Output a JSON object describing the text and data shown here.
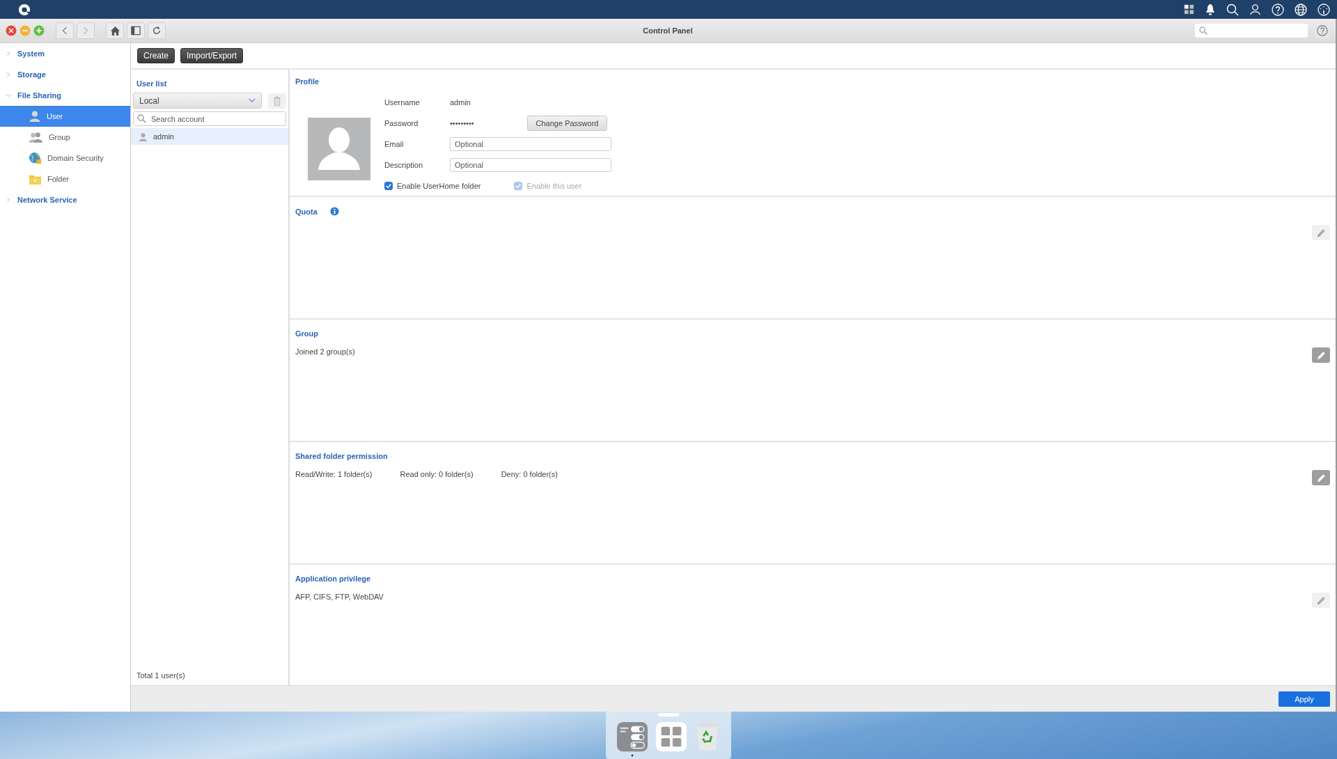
{
  "window": {
    "title": "Control Panel"
  },
  "toolbar": {
    "buttons": [
      "Create",
      "Import/Export"
    ]
  },
  "sidebar": {
    "items": [
      {
        "label": "System",
        "expanded": false
      },
      {
        "label": "Storage",
        "expanded": false
      },
      {
        "label": "File Sharing",
        "expanded": true,
        "children": [
          {
            "label": "User",
            "kind": "user",
            "selected": true
          },
          {
            "label": "Group",
            "kind": "group",
            "selected": false
          },
          {
            "label": "Domain Security",
            "kind": "domain",
            "selected": false
          },
          {
            "label": "Folder",
            "kind": "folder",
            "selected": false
          }
        ]
      },
      {
        "label": "Network Service",
        "expanded": false
      }
    ]
  },
  "user_list": {
    "title": "User list",
    "filter": "Local",
    "search": {
      "placeholder": "Search account"
    },
    "users": [
      {
        "name": "admin",
        "selected": true
      }
    ],
    "total": "Total 1 user(s)"
  },
  "profile": {
    "title": "Profile",
    "fields": [
      {
        "label": "Username",
        "kind": "text",
        "value": "admin"
      },
      {
        "label": "Password",
        "kind": "text",
        "value": "•••••••••",
        "action": "Change Password"
      },
      {
        "label": "Email",
        "kind": "input",
        "placeholder": "Optional"
      },
      {
        "label": "Description",
        "kind": "input",
        "placeholder": "Optional"
      }
    ],
    "checkboxes": [
      {
        "label": "Enable UserHome folder",
        "checked": true,
        "disabled": false
      },
      {
        "label": "Enable this user",
        "checked": true,
        "disabled": true
      }
    ]
  },
  "sections": [
    {
      "title": "Quota",
      "info": true,
      "edit_enabled": false
    },
    {
      "title": "Group",
      "info": false,
      "lines": [
        "Joined 2 group(s)"
      ],
      "edit_enabled": true
    },
    {
      "title": "Shared folder permission",
      "info": false,
      "lines": [
        "Read/Write: 1 folder(s)",
        "Read only: 0 folder(s)",
        "Deny: 0 folder(s)"
      ],
      "edit_enabled": true
    },
    {
      "title": "Application privilege",
      "info": false,
      "lines": [
        "AFP, CIFS, FTP, WebDAV"
      ],
      "edit_enabled": false
    }
  ],
  "apply_button": "Apply"
}
